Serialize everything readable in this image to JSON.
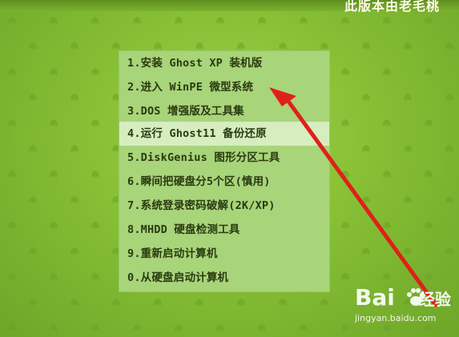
{
  "header": {
    "title": "此版本由老毛桃"
  },
  "menu": {
    "selected_index": 3,
    "items": [
      {
        "label": "1.安装 Ghost XP 装机版"
      },
      {
        "label": "2.进入 WinPE 微型系统"
      },
      {
        "label": "3.DOS 增强版及工具集"
      },
      {
        "label": "4.运行 Ghost11 备份还原"
      },
      {
        "label": "5.DiskGenius 图形分区工具"
      },
      {
        "label": "6.瞬间把硬盘分5个区(慎用)"
      },
      {
        "label": "7.系统登录密码破解(2K/XP)"
      },
      {
        "label": "8.MHDD 硬盘检测工具"
      },
      {
        "label": "9.重新启动计算机"
      },
      {
        "label": "0.从硬盘启动计算机"
      }
    ]
  },
  "watermark": {
    "brand": "Bai",
    "brand_suffix": "经验",
    "url": "jingyan.baidu.com"
  },
  "colors": {
    "background": "#86bf34",
    "menu_background": "#a8d47a",
    "selected_background": "#d6edc0",
    "arrow": "#e0201a"
  }
}
